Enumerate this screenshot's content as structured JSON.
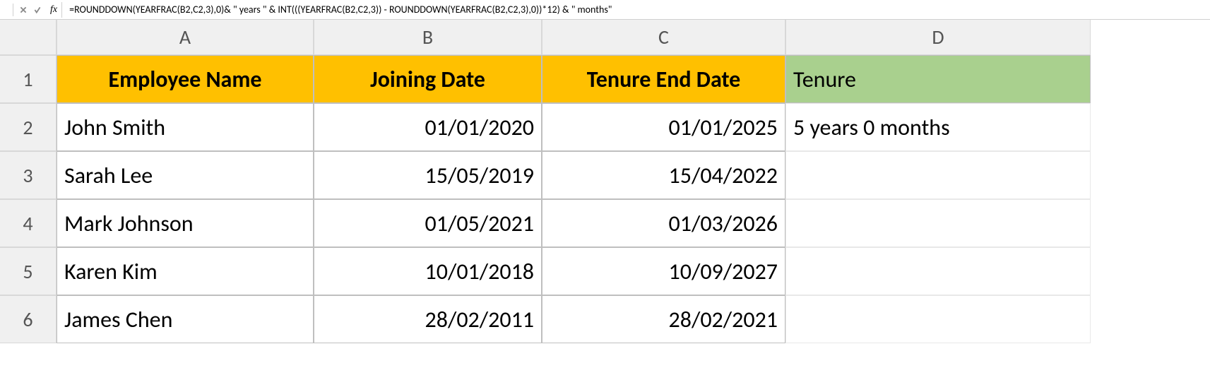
{
  "toolbar": {
    "fx_label": "fx",
    "formula": "=ROUNDDOWN(YEARFRAC(B2,C2,3),0)& \" years \" & INT(((YEARFRAC(B2,C2,3)) - ROUNDDOWN(YEARFRAC(B2,C2,3),0))*12) & \" months\""
  },
  "columns": [
    "A",
    "B",
    "C",
    "D"
  ],
  "rownums": [
    "1",
    "2",
    "3",
    "4",
    "5",
    "6"
  ],
  "headers": {
    "A": "Employee Name",
    "B": "Joining Date",
    "C": "Tenure End Date",
    "D": "Tenure"
  },
  "rows": [
    {
      "name": "John Smith",
      "join": "01/01/2020",
      "end": "01/01/2025",
      "tenure": "5 years 0 months"
    },
    {
      "name": "Sarah Lee",
      "join": "15/05/2019",
      "end": "15/04/2022",
      "tenure": ""
    },
    {
      "name": "Mark Johnson",
      "join": "01/05/2021",
      "end": "01/03/2026",
      "tenure": ""
    },
    {
      "name": "Karen Kim",
      "join": "10/01/2018",
      "end": "10/09/2027",
      "tenure": ""
    },
    {
      "name": "James Chen",
      "join": "28/02/2011",
      "end": "28/02/2021",
      "tenure": ""
    }
  ]
}
